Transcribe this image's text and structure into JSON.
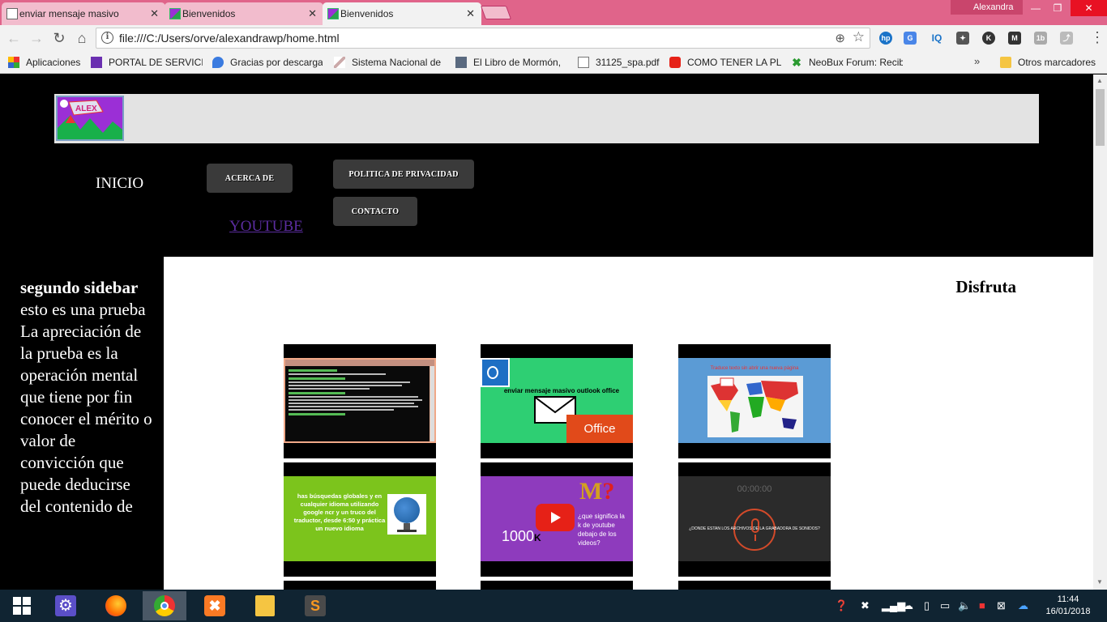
{
  "browser": {
    "tabs": [
      {
        "title": "enviar mensaje masivo",
        "favicon": "document-icon"
      },
      {
        "title": "Bienvenidos",
        "favicon": "alex-logo-icon"
      },
      {
        "title": "Bienvenidos",
        "favicon": "alex-logo-icon",
        "active": true
      }
    ],
    "profile_name": "Alexandra",
    "url": "file:///C:/Users/orve/alexandrawp/home.html",
    "bookmarks": [
      {
        "label": "Aplicaciones",
        "icon": "apps-grid-icon"
      },
      {
        "label": "PORTAL DE SERVICIO",
        "icon": "portal-icon"
      },
      {
        "label": "Gracias por descarga",
        "icon": "drop-icon"
      },
      {
        "label": "Sistema Nacional de",
        "icon": "pen-icon"
      },
      {
        "label": "El Libro de Mormón,",
        "icon": "book-icon"
      },
      {
        "label": "31125_spa.pdf",
        "icon": "document-icon"
      },
      {
        "label": "COMO TENER LA PLA",
        "icon": "youtube-icon"
      },
      {
        "label": "NeoBux Forum: Recib",
        "icon": "neobux-icon"
      }
    ],
    "bookmarks_more": "»",
    "other_bookmarks": "Otros marcadores"
  },
  "page": {
    "nav": {
      "inicio": "INICIO",
      "acerca": "ACERCA DE",
      "politica": "POLITICA DE PRIVACIDAD",
      "contacto": "CONTACTO",
      "youtube": "YOUTUBE"
    },
    "sidebar": {
      "title": "segundo sidebar",
      "body": "esto es una prueba La apreciación de la prueba es la operación mental que tiene por fin conocer el mérito o valor de convicción que puede deducirse del contenido de"
    },
    "main": {
      "heading": "Disfruta",
      "videos": [
        {
          "id": "terminal",
          "caption": ""
        },
        {
          "id": "outlook",
          "caption": "enviar mensaje masivo outlook office",
          "badge": "Office"
        },
        {
          "id": "map",
          "caption": "Traduce texto sin abrir una nueva página"
        },
        {
          "id": "globe",
          "caption": "has búsquedas globales y en cualquier idioma utilizando google ncr y un truco del traductor, desde 6:50 y práctica un nuevo idioma"
        },
        {
          "id": "youtube",
          "caption": "¿que significa la k de youtube debajo de los videos?",
          "count": "1000"
        },
        {
          "id": "recorder",
          "caption": "¿DONDE ESTAN LOS ARCHIVOS DE LA GRABADORA DE SONIDOS?",
          "time": "00:00:00"
        }
      ]
    }
  },
  "taskbar": {
    "time": "11:44",
    "date": "16/01/2018"
  },
  "colors": {
    "tabstrip": "#e0648a",
    "page_bg": "#000000",
    "nav_button": "#3a3a3a",
    "youtube_link": "#5a2c9e"
  }
}
